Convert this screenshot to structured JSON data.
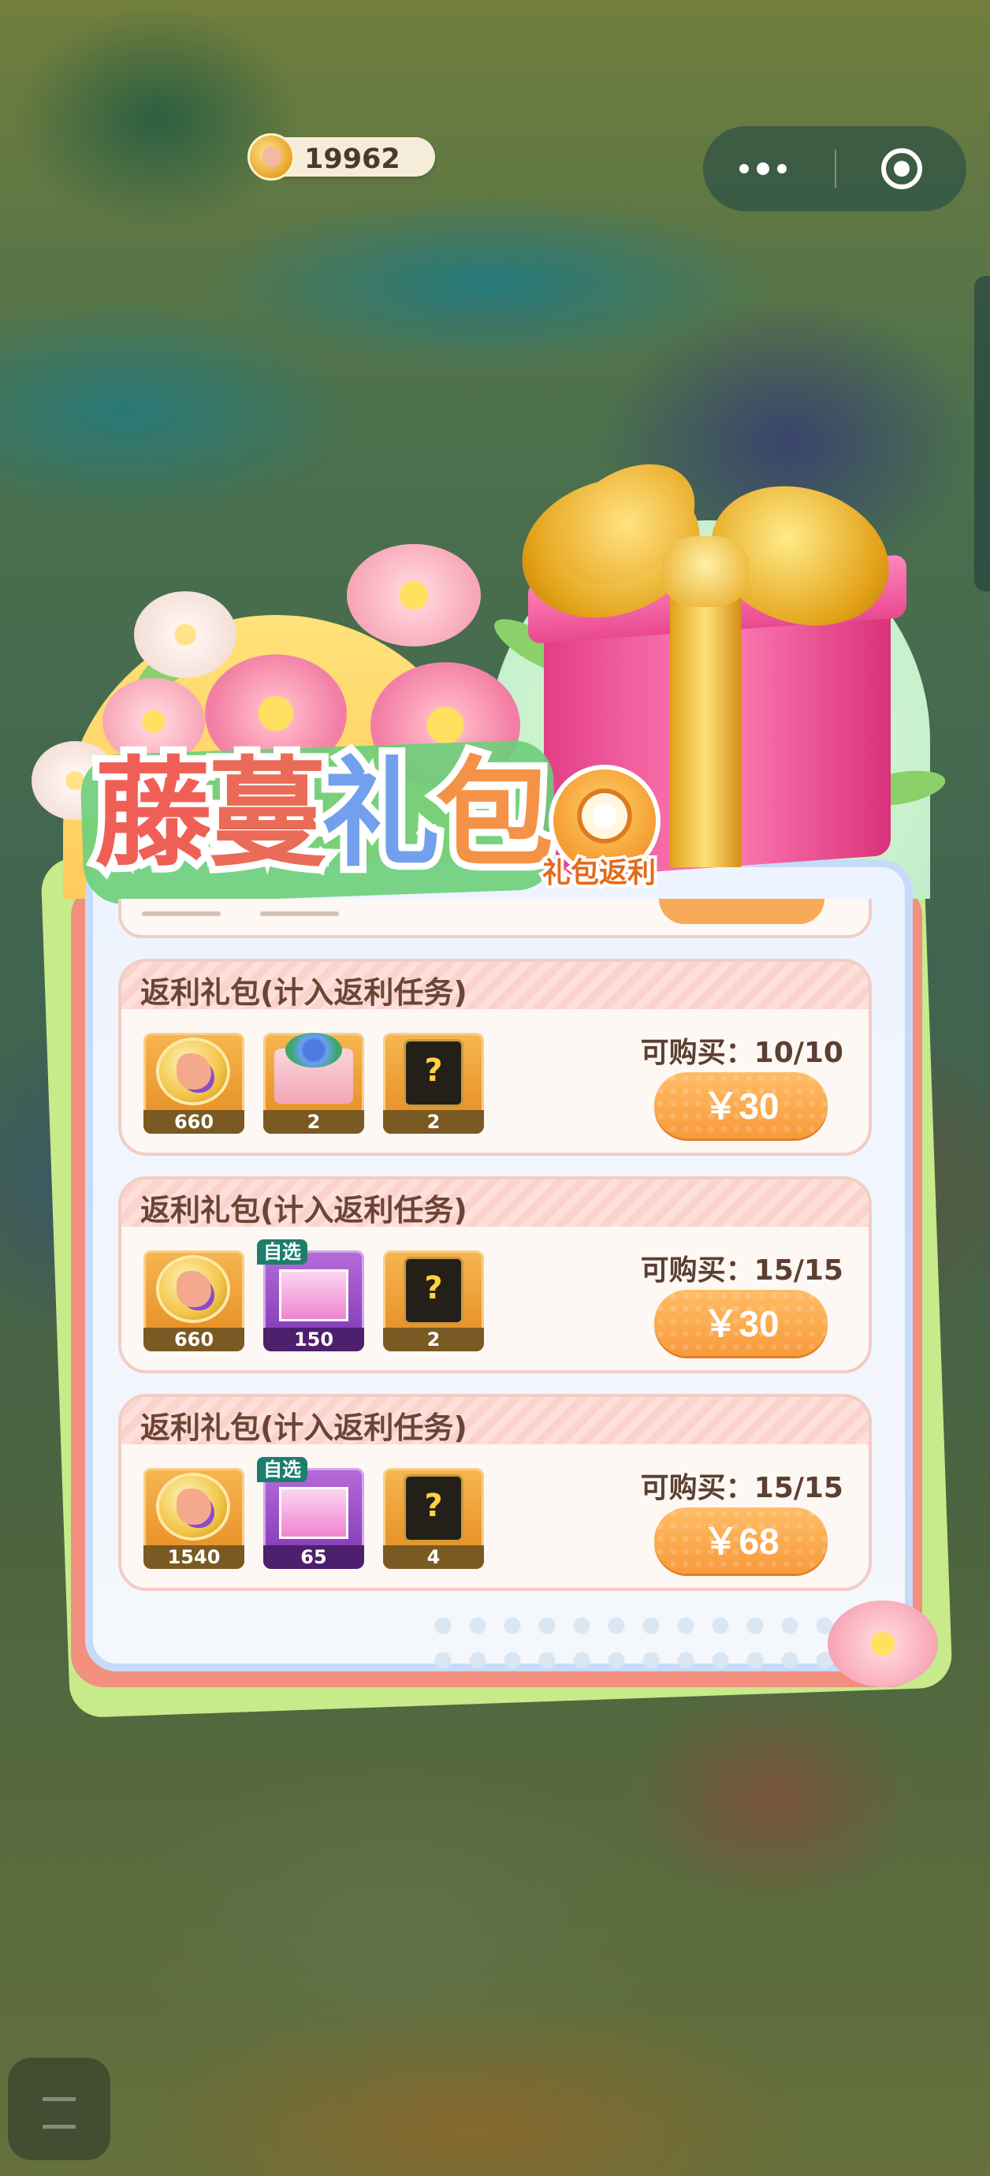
{
  "top_bar": {
    "coin_balance": "19962"
  },
  "title": {
    "chars": [
      "藤",
      "蔓",
      "礼",
      "包"
    ],
    "rebate_label": "礼包返利"
  },
  "packs": [
    {
      "title": "返利礼包(计入返利任务)",
      "limit": "可购买：10/10",
      "price": "￥30",
      "items": [
        {
          "type": "coin",
          "count": "660",
          "tag": ""
        },
        {
          "type": "envelope",
          "count": "2",
          "tag": ""
        },
        {
          "type": "mystery-card",
          "count": "2",
          "tag": ""
        }
      ]
    },
    {
      "title": "返利礼包(计入返利任务)",
      "limit": "可购买：15/15",
      "price": "￥30",
      "items": [
        {
          "type": "coin",
          "count": "660",
          "tag": ""
        },
        {
          "type": "gift-box",
          "count": "150",
          "tag": "自选"
        },
        {
          "type": "mystery-card",
          "count": "2",
          "tag": ""
        }
      ]
    },
    {
      "title": "返利礼包(计入返利任务)",
      "limit": "可购买：15/15",
      "price": "￥68",
      "items": [
        {
          "type": "coin",
          "count": "1540",
          "tag": ""
        },
        {
          "type": "gift-box",
          "count": "65",
          "tag": "自选"
        },
        {
          "type": "mystery-card",
          "count": "4",
          "tag": ""
        }
      ]
    }
  ],
  "colors": {
    "price_button": "#f89a3c",
    "card_border": "#f2cdc4",
    "panel_border": "#c6dbf8"
  }
}
